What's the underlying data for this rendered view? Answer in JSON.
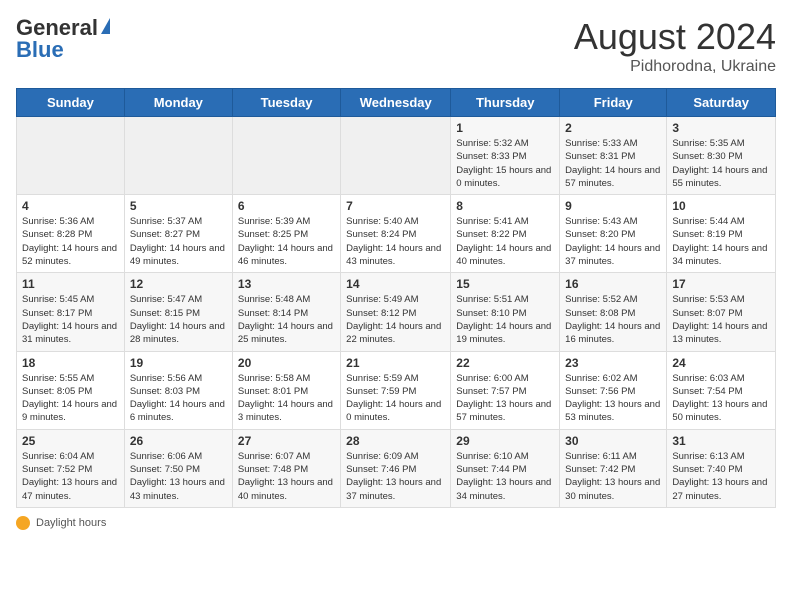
{
  "header": {
    "logo_general": "General",
    "logo_blue": "Blue",
    "title": "August 2024",
    "location": "Pidhorodna, Ukraine"
  },
  "days_of_week": [
    "Sunday",
    "Monday",
    "Tuesday",
    "Wednesday",
    "Thursday",
    "Friday",
    "Saturday"
  ],
  "weeks": [
    [
      {
        "num": "",
        "info": ""
      },
      {
        "num": "",
        "info": ""
      },
      {
        "num": "",
        "info": ""
      },
      {
        "num": "",
        "info": ""
      },
      {
        "num": "1",
        "info": "Sunrise: 5:32 AM\nSunset: 8:33 PM\nDaylight: 15 hours and 0 minutes."
      },
      {
        "num": "2",
        "info": "Sunrise: 5:33 AM\nSunset: 8:31 PM\nDaylight: 14 hours and 57 minutes."
      },
      {
        "num": "3",
        "info": "Sunrise: 5:35 AM\nSunset: 8:30 PM\nDaylight: 14 hours and 55 minutes."
      }
    ],
    [
      {
        "num": "4",
        "info": "Sunrise: 5:36 AM\nSunset: 8:28 PM\nDaylight: 14 hours and 52 minutes."
      },
      {
        "num": "5",
        "info": "Sunrise: 5:37 AM\nSunset: 8:27 PM\nDaylight: 14 hours and 49 minutes."
      },
      {
        "num": "6",
        "info": "Sunrise: 5:39 AM\nSunset: 8:25 PM\nDaylight: 14 hours and 46 minutes."
      },
      {
        "num": "7",
        "info": "Sunrise: 5:40 AM\nSunset: 8:24 PM\nDaylight: 14 hours and 43 minutes."
      },
      {
        "num": "8",
        "info": "Sunrise: 5:41 AM\nSunset: 8:22 PM\nDaylight: 14 hours and 40 minutes."
      },
      {
        "num": "9",
        "info": "Sunrise: 5:43 AM\nSunset: 8:20 PM\nDaylight: 14 hours and 37 minutes."
      },
      {
        "num": "10",
        "info": "Sunrise: 5:44 AM\nSunset: 8:19 PM\nDaylight: 14 hours and 34 minutes."
      }
    ],
    [
      {
        "num": "11",
        "info": "Sunrise: 5:45 AM\nSunset: 8:17 PM\nDaylight: 14 hours and 31 minutes."
      },
      {
        "num": "12",
        "info": "Sunrise: 5:47 AM\nSunset: 8:15 PM\nDaylight: 14 hours and 28 minutes."
      },
      {
        "num": "13",
        "info": "Sunrise: 5:48 AM\nSunset: 8:14 PM\nDaylight: 14 hours and 25 minutes."
      },
      {
        "num": "14",
        "info": "Sunrise: 5:49 AM\nSunset: 8:12 PM\nDaylight: 14 hours and 22 minutes."
      },
      {
        "num": "15",
        "info": "Sunrise: 5:51 AM\nSunset: 8:10 PM\nDaylight: 14 hours and 19 minutes."
      },
      {
        "num": "16",
        "info": "Sunrise: 5:52 AM\nSunset: 8:08 PM\nDaylight: 14 hours and 16 minutes."
      },
      {
        "num": "17",
        "info": "Sunrise: 5:53 AM\nSunset: 8:07 PM\nDaylight: 14 hours and 13 minutes."
      }
    ],
    [
      {
        "num": "18",
        "info": "Sunrise: 5:55 AM\nSunset: 8:05 PM\nDaylight: 14 hours and 9 minutes."
      },
      {
        "num": "19",
        "info": "Sunrise: 5:56 AM\nSunset: 8:03 PM\nDaylight: 14 hours and 6 minutes."
      },
      {
        "num": "20",
        "info": "Sunrise: 5:58 AM\nSunset: 8:01 PM\nDaylight: 14 hours and 3 minutes."
      },
      {
        "num": "21",
        "info": "Sunrise: 5:59 AM\nSunset: 7:59 PM\nDaylight: 14 hours and 0 minutes."
      },
      {
        "num": "22",
        "info": "Sunrise: 6:00 AM\nSunset: 7:57 PM\nDaylight: 13 hours and 57 minutes."
      },
      {
        "num": "23",
        "info": "Sunrise: 6:02 AM\nSunset: 7:56 PM\nDaylight: 13 hours and 53 minutes."
      },
      {
        "num": "24",
        "info": "Sunrise: 6:03 AM\nSunset: 7:54 PM\nDaylight: 13 hours and 50 minutes."
      }
    ],
    [
      {
        "num": "25",
        "info": "Sunrise: 6:04 AM\nSunset: 7:52 PM\nDaylight: 13 hours and 47 minutes."
      },
      {
        "num": "26",
        "info": "Sunrise: 6:06 AM\nSunset: 7:50 PM\nDaylight: 13 hours and 43 minutes."
      },
      {
        "num": "27",
        "info": "Sunrise: 6:07 AM\nSunset: 7:48 PM\nDaylight: 13 hours and 40 minutes."
      },
      {
        "num": "28",
        "info": "Sunrise: 6:09 AM\nSunset: 7:46 PM\nDaylight: 13 hours and 37 minutes."
      },
      {
        "num": "29",
        "info": "Sunrise: 6:10 AM\nSunset: 7:44 PM\nDaylight: 13 hours and 34 minutes."
      },
      {
        "num": "30",
        "info": "Sunrise: 6:11 AM\nSunset: 7:42 PM\nDaylight: 13 hours and 30 minutes."
      },
      {
        "num": "31",
        "info": "Sunrise: 6:13 AM\nSunset: 7:40 PM\nDaylight: 13 hours and 27 minutes."
      }
    ]
  ],
  "footer": {
    "daylight_label": "Daylight hours"
  }
}
